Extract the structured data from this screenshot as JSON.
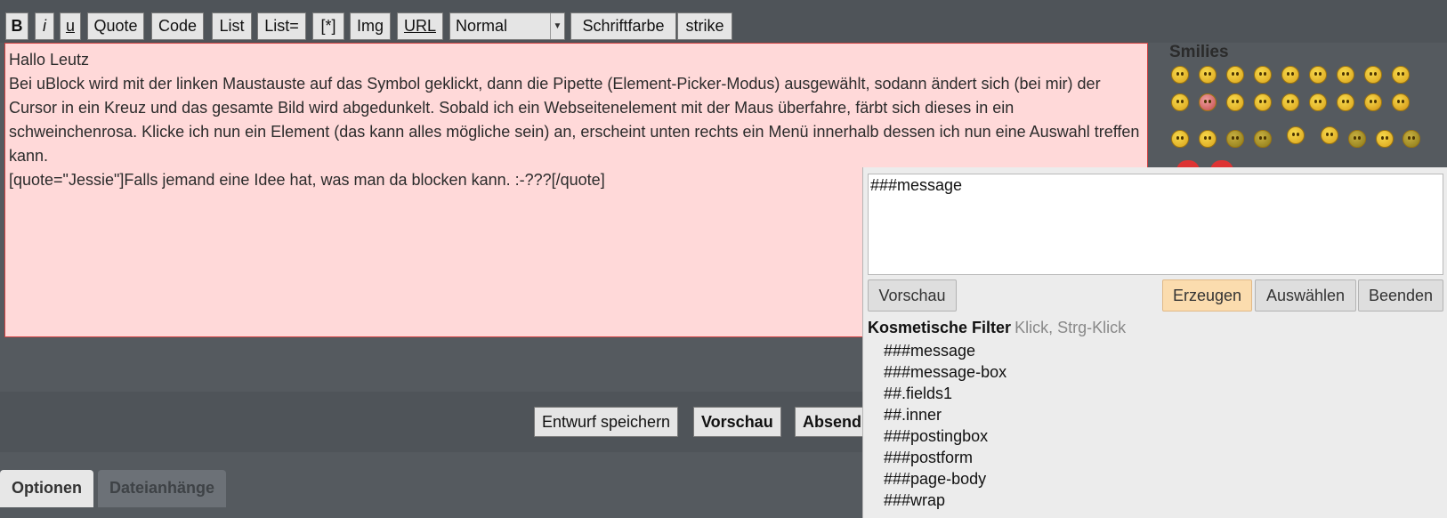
{
  "toolbar": {
    "buttons": {
      "bold": "B",
      "italic": "i",
      "underline": "u",
      "quote": "Quote",
      "code": "Code",
      "list": "List",
      "list_eq": "List=",
      "list_item": "[*]",
      "img": "Img",
      "url": "URL",
      "color": "Schriftfarbe",
      "strike": "strike"
    },
    "size_select": "Normal"
  },
  "editor": {
    "lines": [
      "Hallo Leutz",
      "Bei uBlock wird mit der linken Maustauste auf das Symbol geklickt, dann die Pipette (Element-Picker-Modus) ausgewählt, sodann ändert sich (bei mir) der Cursor in ein Kreuz und das gesamte Bild wird abgedunkelt. Sobald ich ein Webseitenelement mit der Maus überfahre, färbt sich dieses in ein schweinchenrosa. Klicke ich nun ein Element (das kann alles mögliche sein) an, erscheint unten rechts ein Menü innerhalb dessen ich nun eine Auswahl treffen kann.",
      "[quote=\"Jessie\"]Falls jemand eine Idee hat, was man da blocken kann. :-???[/quote]"
    ]
  },
  "smilies": {
    "title": "Smilies"
  },
  "form": {
    "save_draft": "Entwurf speichern",
    "preview": "Vorschau",
    "submit": "Absend"
  },
  "tabs": {
    "options": "Optionen",
    "attachments": "Dateianhänge"
  },
  "picker": {
    "filter_text": "###message",
    "buttons": {
      "preview": "Vorschau",
      "create": "Erzeugen",
      "select": "Auswählen",
      "quit": "Beenden"
    },
    "section_title": "Kosmetische Filter",
    "section_hint": "Klick, Strg-Klick",
    "filters": [
      "###message",
      "###message-box",
      "##.fields1",
      "##.inner",
      "###postingbox",
      "###postform",
      "###page-body",
      "###wrap"
    ]
  }
}
